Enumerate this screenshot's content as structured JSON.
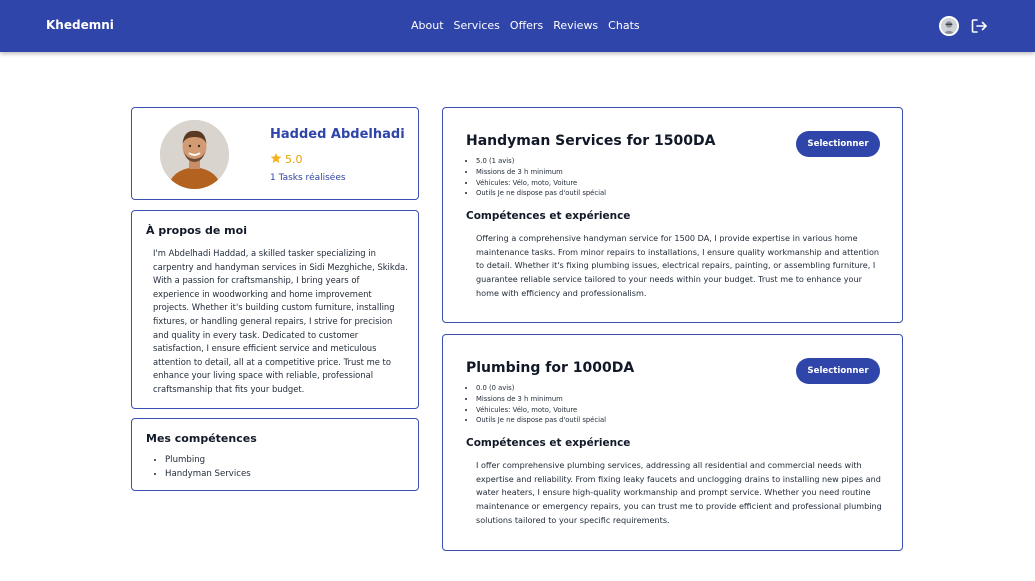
{
  "navbar": {
    "brand": "Khedemni",
    "links": [
      "About",
      "Services",
      "Offers",
      "Reviews",
      "Chats"
    ]
  },
  "profile": {
    "name": "Hadded Abdelhadi",
    "rating": "5.0",
    "tasks": "1 Tasks réalisées"
  },
  "about": {
    "title": "À propos de moi",
    "text": "I'm Abdelhadi Haddad, a skilled tasker specializing in carpentry and handyman services in Sidi Mezghiche, Skikda. With a passion for craftsmanship, I bring years of experience in woodworking and home improvement projects. Whether it's building custom furniture, installing fixtures, or handling general repairs, I strive for precision and quality in every task. Dedicated to customer satisfaction, I ensure efficient service and meticulous attention to detail, all at a competitive price. Trust me to enhance your living space with reliable, professional craftsmanship that fits your budget."
  },
  "skills": {
    "title": "Mes compétences",
    "items": [
      "Plumbing",
      "Handyman Services"
    ]
  },
  "services": [
    {
      "title": "Handyman Services for 1500DA",
      "button": "Selectionner",
      "meta": [
        "5.0 (1 avis)",
        "Missions de 3 h minimum",
        "Véhicules: Vélo, moto, Voiture",
        "Outils Je ne dispose pas d'outil spécial"
      ],
      "subtitle": "Compétences et expérience",
      "description": "Offering a comprehensive handyman service for 1500 DA, I provide expertise in various home maintenance tasks. From minor repairs to installations, I ensure quality workmanship and attention to detail. Whether it's fixing plumbing issues, electrical repairs, painting, or assembling furniture, I guarantee reliable service tailored to your needs within your budget. Trust me to enhance your home with efficiency and professionalism."
    },
    {
      "title": "Plumbing for 1000DA",
      "button": "Selectionner",
      "meta": [
        "0.0 (0 avis)",
        "Missions de 3 h minimum",
        "Véhicules: Vélo, moto, Voiture",
        "Outils Je ne dispose pas d'outil spécial"
      ],
      "subtitle": "Compétences et expérience",
      "description": "I offer comprehensive plumbing services, addressing all residential and commercial needs with expertise and reliability. From fixing leaky faucets and unclogging drains to installing new pipes and water heaters, I ensure high-quality workmanship and prompt service. Whether you need routine maintenance or emergency repairs, you can trust me to provide efficient and professional plumbing solutions tailored to your specific requirements."
    }
  ],
  "colors": {
    "brand_blue": "#2f45a9",
    "star": "#e3a008"
  },
  "icons": {
    "rating": "star-icon",
    "logout": "logout-icon",
    "user": "user-avatar"
  }
}
